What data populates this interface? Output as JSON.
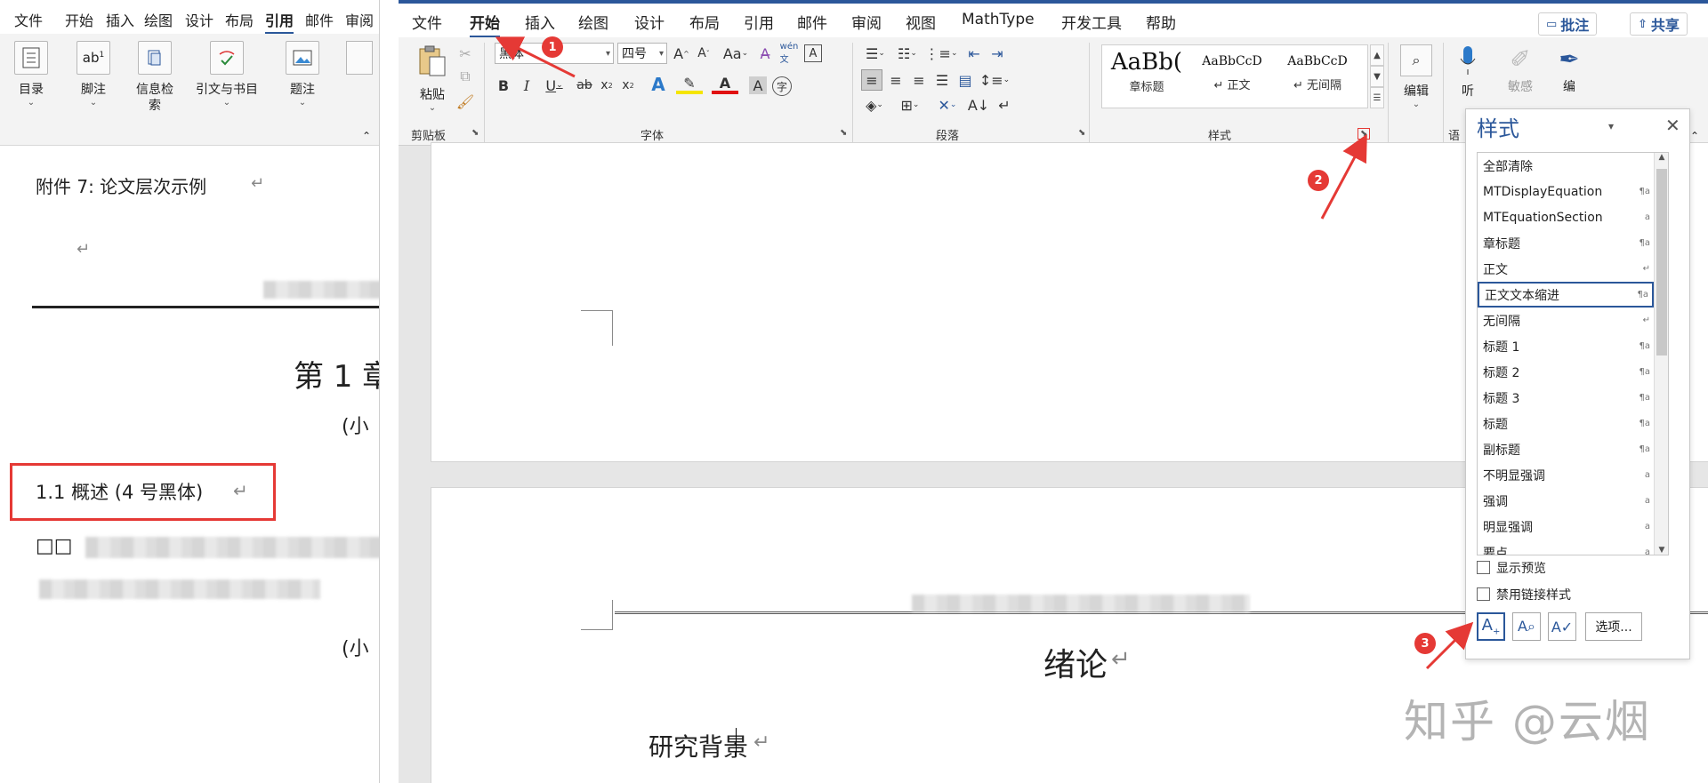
{
  "left_window": {
    "tabs": [
      "文件",
      "开始",
      "插入",
      "绘图",
      "设计",
      "布局",
      "引用",
      "邮件",
      "审阅"
    ],
    "active_tab_index": 6,
    "ribbon_buttons": [
      {
        "label": "目录",
        "icon": "toc-icon"
      },
      {
        "label": "脚注",
        "icon": "footnote-icon"
      },
      {
        "label": "信息检索",
        "icon": "research-icon"
      },
      {
        "label": "引文与书目",
        "icon": "citation-icon"
      },
      {
        "label": "题注",
        "icon": "caption-icon"
      }
    ],
    "doc": {
      "attachment_title": "附件 7:   论文层次示例",
      "chapter_heading": "第 1 章",
      "note_small_1": "(小",
      "section_heading": "1.1    概述 (4 号黑体)",
      "placeholder_boxes": "□□",
      "note_small_2": "(小",
      "para_mark": "↵"
    }
  },
  "right_window": {
    "tabs": [
      "文件",
      "开始",
      "插入",
      "绘图",
      "设计",
      "布局",
      "引用",
      "邮件",
      "审阅",
      "视图",
      "MathType",
      "开发工具",
      "帮助"
    ],
    "active_tab_index": 1,
    "comments_button": "批注",
    "share_button": "共享",
    "ribbon": {
      "clipboard": {
        "paste_label": "粘贴",
        "group_label": "剪贴板"
      },
      "font": {
        "font_name": "黑体",
        "font_size": "四号",
        "group_label": "字体"
      },
      "paragraph": {
        "group_label": "段落"
      },
      "styles": {
        "group_label": "样式",
        "gallery": [
          {
            "sample": "AaBb(",
            "name": "章标题"
          },
          {
            "sample": "AaBbCcD",
            "name": "↵ 正文"
          },
          {
            "sample": "AaBbCcD",
            "name": "↵ 无间隔"
          }
        ]
      },
      "editing": {
        "label": "编辑"
      },
      "voice": {
        "label": "听"
      },
      "sensitivity": {
        "label": "敏感"
      },
      "editor": {
        "label": "编"
      },
      "partial_group_label": "语"
    },
    "doc": {
      "title": "绪论",
      "subheading": "研究背景",
      "para_mark": "↵"
    }
  },
  "styles_pane": {
    "title": "样式",
    "items": [
      {
        "name": "全部清除",
        "marker": ""
      },
      {
        "name": "MTDisplayEquation",
        "marker": "¶a"
      },
      {
        "name": "MTEquationSection",
        "marker": "a"
      },
      {
        "name": "章标题",
        "marker": "¶a"
      },
      {
        "name": "正文",
        "marker": "↵"
      },
      {
        "name": "正文文本缩进",
        "marker": "¶a"
      },
      {
        "name": "无间隔",
        "marker": "↵"
      },
      {
        "name": "标题 1",
        "marker": "¶a"
      },
      {
        "name": "标题 2",
        "marker": "¶a"
      },
      {
        "name": "标题 3",
        "marker": "¶a"
      },
      {
        "name": "标题",
        "marker": "¶a"
      },
      {
        "name": "副标题",
        "marker": "¶a"
      },
      {
        "name": "不明显强调",
        "marker": "a"
      },
      {
        "name": "强调",
        "marker": "a"
      },
      {
        "name": "明显强调",
        "marker": "a"
      },
      {
        "name": "要点",
        "marker": "a"
      }
    ],
    "selected_index": 5,
    "show_preview_label": "显示预览",
    "disable_linked_label": "禁用链接样式",
    "options_button": "选项..."
  },
  "annotations": [
    "1",
    "2",
    "3"
  ],
  "watermark": "知乎 @云烟",
  "colors": {
    "accent": "#2b579a",
    "annotation_red": "#e53935"
  }
}
